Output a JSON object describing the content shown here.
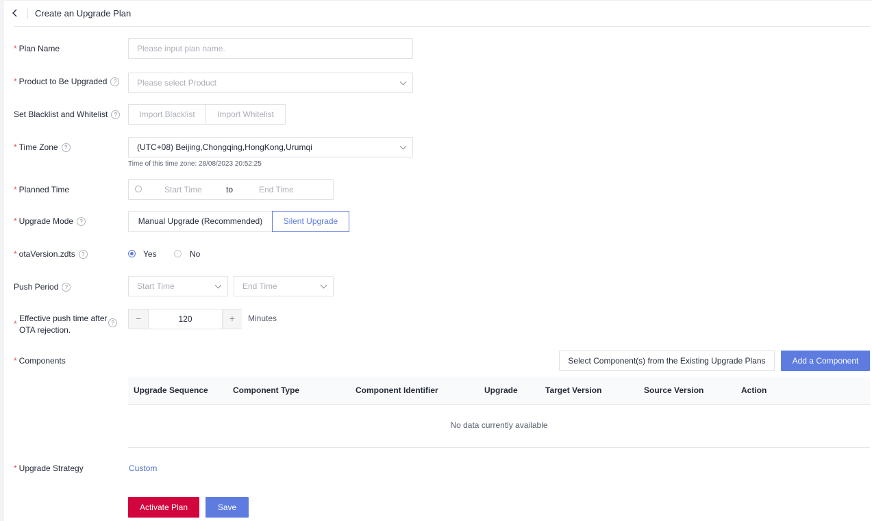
{
  "header": {
    "title": "Create an Upgrade Plan"
  },
  "form": {
    "plan_name": {
      "label": "Plan Name",
      "placeholder": "Please input plan name."
    },
    "product": {
      "label": "Product to Be Upgraded",
      "placeholder": "Please select Product"
    },
    "blackwhite": {
      "label": "Set Blacklist and Whitelist",
      "import_blacklist": "Import Blacklist",
      "import_whitelist": "Import Whitelist"
    },
    "time_zone": {
      "label": "Time Zone",
      "value": "(UTC+08) Beijing,Chongqing,HongKong,Urumqi",
      "hint": "Time of this time zone: 28/08/2023 20:52:25"
    },
    "planned_time": {
      "label": "Planned Time",
      "start_placeholder": "Start Time",
      "separator": "to",
      "end_placeholder": "End Time"
    },
    "upgrade_mode": {
      "label": "Upgrade Mode",
      "options": [
        "Manual Upgrade (Recommended)",
        "Silent Upgrade"
      ],
      "selected": "Silent Upgrade"
    },
    "ota_version": {
      "label": "otaVersion.zdts",
      "options": [
        "Yes",
        "No"
      ],
      "selected": "Yes"
    },
    "push_period": {
      "label": "Push Period",
      "start_placeholder": "Start Time",
      "end_placeholder": "End Time"
    },
    "effective_push": {
      "label_line1": "Effective push time after",
      "label_line2": "OTA rejection.",
      "value": "120",
      "unit": "Minutes",
      "minus": "−",
      "plus": "+"
    },
    "components": {
      "label": "Components",
      "select_existing": "Select Component(s) from the Existing Upgrade Plans",
      "add": "Add a Component",
      "columns": [
        "Upgrade Sequence",
        "Component Type",
        "Component Identifier",
        "Upgrade",
        "Target Version",
        "Source Version",
        "Action"
      ],
      "empty": "No data currently available"
    },
    "strategy": {
      "label": "Upgrade Strategy",
      "value": "Custom"
    }
  },
  "actions": {
    "activate": "Activate Plan",
    "save": "Save"
  },
  "colors": {
    "accent": "#5e7ce0",
    "danger": "#d3053e",
    "required": "#e6504e"
  }
}
